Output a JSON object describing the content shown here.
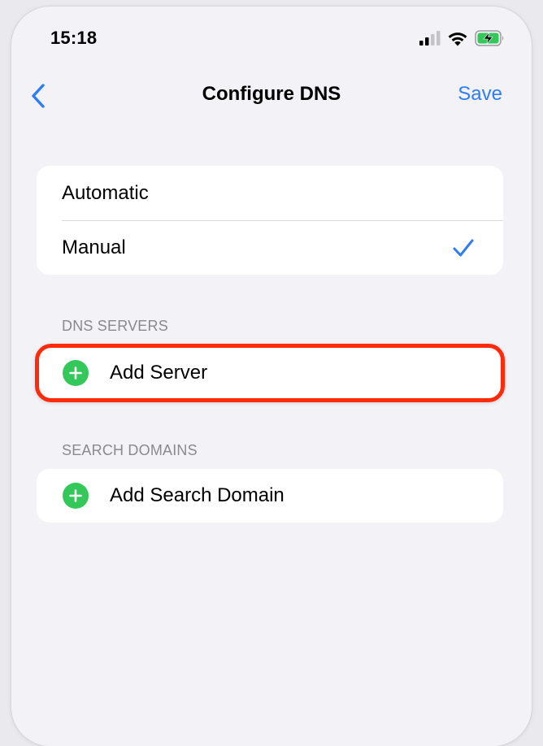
{
  "status_bar": {
    "time": "15:18",
    "icons": [
      "cellular-signal-icon",
      "wifi-icon",
      "battery-charging-icon"
    ]
  },
  "nav": {
    "title": "Configure DNS",
    "back_icon": "chevron-left-icon",
    "save_label": "Save"
  },
  "mode": {
    "options": [
      {
        "label": "Automatic",
        "selected": false
      },
      {
        "label": "Manual",
        "selected": true
      }
    ]
  },
  "dns_servers": {
    "header": "DNS SERVERS",
    "add_label": "Add Server"
  },
  "search_domains": {
    "header": "SEARCH DOMAINS",
    "add_label": "Add Search Domain"
  },
  "colors": {
    "accent": "#2f7cf6",
    "add_green": "#34c759",
    "highlight": "#ff2a0a",
    "background": "#f2f2f7"
  }
}
